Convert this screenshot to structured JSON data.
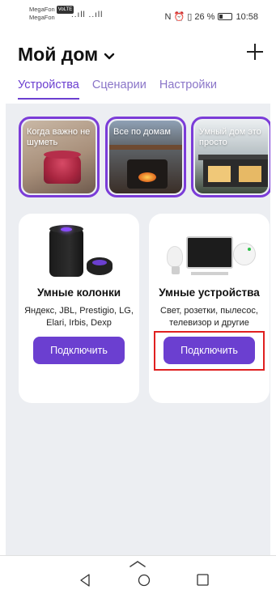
{
  "status_bar": {
    "operator1": "MegaFon",
    "volte": "VoLTE",
    "operator2": "MegaFon",
    "signal": "..ıll ..ıll",
    "right_text": "N ⏰ ▯ 26 %",
    "time": "10:58"
  },
  "header": {
    "title": "Мой дом",
    "tabs": [
      {
        "label": "Устройства",
        "active": true
      },
      {
        "label": "Сценарии",
        "active": false
      },
      {
        "label": "Настройки",
        "active": false
      }
    ]
  },
  "stories": [
    {
      "text": "Когда важно не шуметь"
    },
    {
      "text": "Все по домам"
    },
    {
      "text": "Умный дом это просто"
    }
  ],
  "cards": [
    {
      "title": "Умные колонки",
      "description": "Яндекс, JBL, Prestigio, LG, Elari, Irbis, Dexp",
      "button": "Подключить"
    },
    {
      "title": "Умные устройства",
      "description": "Свет, розетки, пылесос, телевизор и другие",
      "button": "Подключить"
    }
  ],
  "colors": {
    "accent": "#6b3fd0",
    "highlight": "#e02020",
    "background": "#eceef2"
  },
  "icons": {
    "add": "plus-icon",
    "chevron": "chevron-down-icon",
    "back": "back-icon",
    "home": "home-icon",
    "recent": "recent-apps-icon"
  }
}
